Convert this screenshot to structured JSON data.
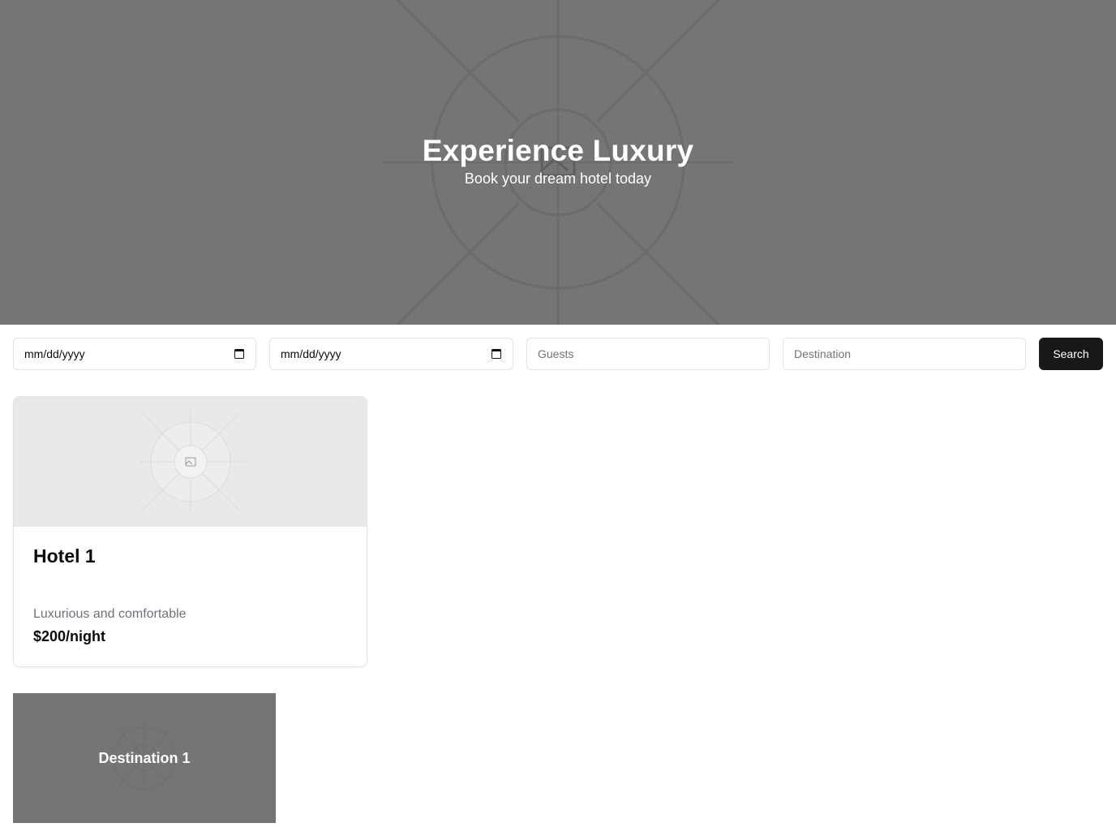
{
  "hero": {
    "title": "Experience Luxury",
    "subtitle": "Book your dream hotel today",
    "image_icon": "image-placeholder-icon"
  },
  "search": {
    "checkin_value": "mm/dd/yyyy",
    "checkout_value": "mm/dd/yyyy",
    "guests_placeholder": "Guests",
    "destination_placeholder": "Destination",
    "button_label": "Search",
    "calendar_icon": "calendar-icon"
  },
  "hotels": [
    {
      "name": "Hotel 1",
      "description": "Luxurious and comfortable",
      "price": "$200/night",
      "image_icon": "image-placeholder-icon"
    }
  ],
  "destinations": [
    {
      "name": "Destination 1"
    }
  ],
  "colors": {
    "hero_bg": "#757575",
    "button_bg": "#18181b",
    "card_border": "#e4e4e7",
    "muted_text": "#71717a"
  }
}
